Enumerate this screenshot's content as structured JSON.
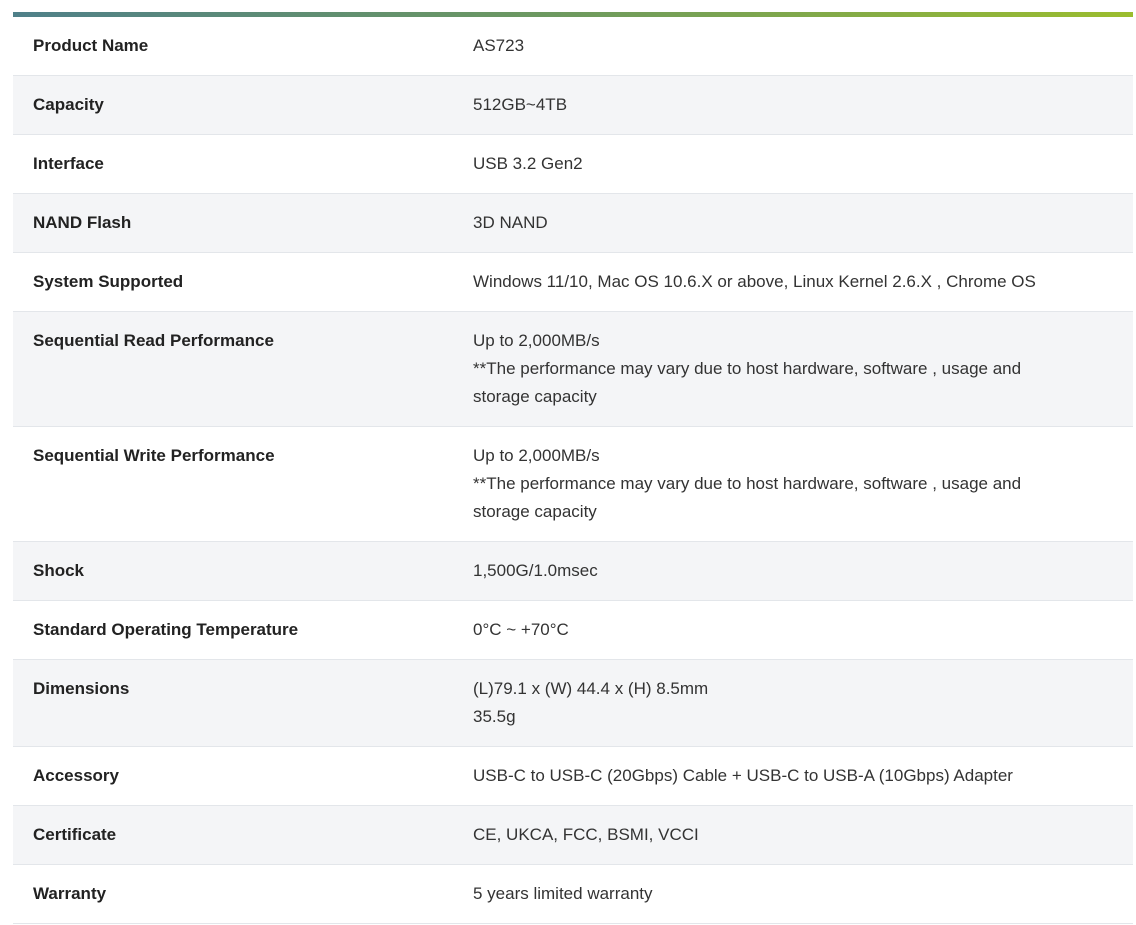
{
  "spec_table": {
    "rows": [
      {
        "label": "Product Name",
        "lines": [
          "AS723"
        ]
      },
      {
        "label": "Capacity",
        "lines": [
          "512GB~4TB"
        ]
      },
      {
        "label": "Interface",
        "lines": [
          "USB 3.2 Gen2"
        ]
      },
      {
        "label": "NAND Flash",
        "lines": [
          "3D NAND"
        ]
      },
      {
        "label": "System Supported",
        "lines": [
          "Windows 11/10, Mac OS 10.6.X or above, Linux Kernel 2.6.X , Chrome OS"
        ]
      },
      {
        "label": "Sequential Read Performance",
        "lines": [
          "Up to 2,000MB/s",
          "**The performance may vary due to host hardware, software , usage and storage capacity"
        ]
      },
      {
        "label": "Sequential Write Performance",
        "lines": [
          "Up to 2,000MB/s",
          "**The performance may vary due to host hardware, software , usage and storage capacity"
        ]
      },
      {
        "label": "Shock",
        "lines": [
          "1,500G/1.0msec"
        ]
      },
      {
        "label": "Standard Operating Temperature",
        "lines": [
          "0°C ~ +70°C"
        ]
      },
      {
        "label": "Dimensions",
        "lines": [
          "(L)79.1 x (W) 44.4 x (H) 8.5mm",
          "35.5g"
        ]
      },
      {
        "label": "Accessory",
        "lines": [
          "USB-C to USB-C (20Gbps) Cable + USB-C to USB-A (10Gbps) Adapter"
        ]
      },
      {
        "label": "Certificate",
        "lines": [
          "CE, UKCA, FCC, BSMI, VCCI"
        ]
      },
      {
        "label": "Warranty",
        "lines": [
          "5 years limited warranty"
        ]
      }
    ]
  },
  "colors": {
    "accent_gradient_start": "#4f8089",
    "accent_gradient_end": "#9bbd2e",
    "row_alt_background": "#f4f5f7",
    "row_border": "#e3e6ea"
  }
}
